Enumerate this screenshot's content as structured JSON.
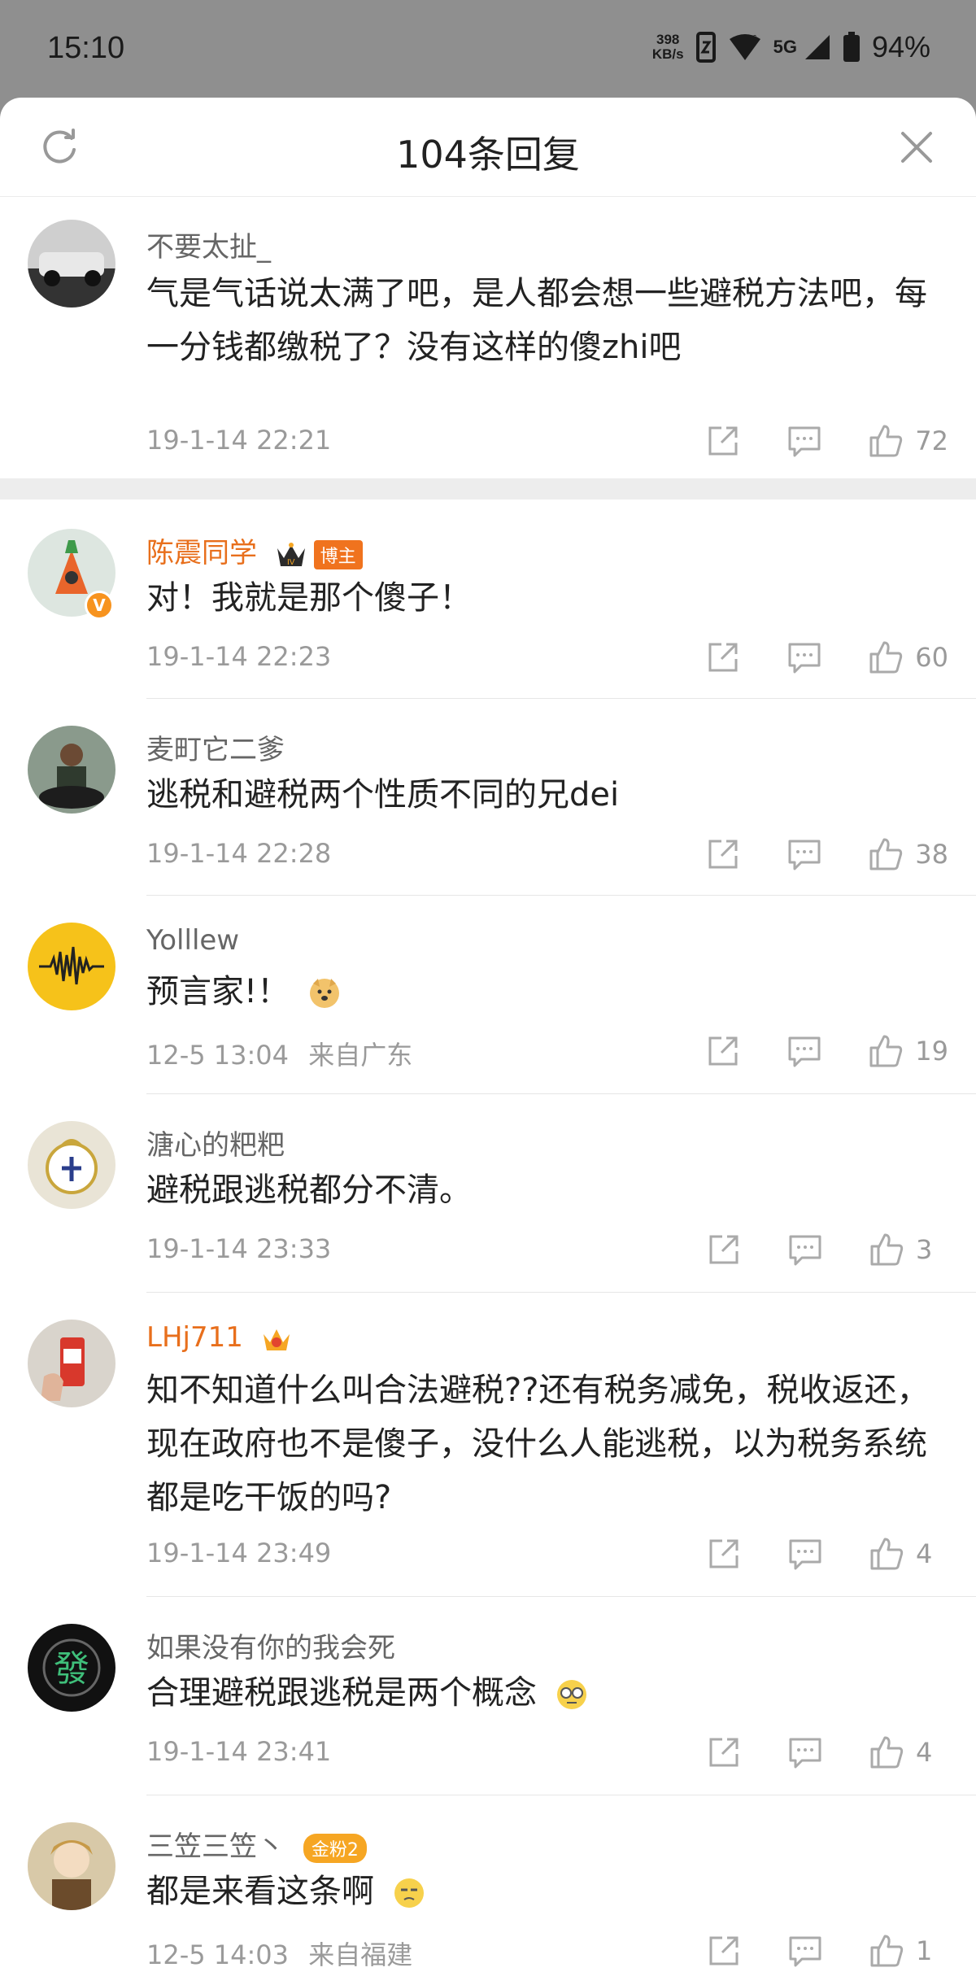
{
  "status_bar": {
    "time": "15:10",
    "net_speed_value": "398",
    "net_speed_unit": "KB/s",
    "network": "5G",
    "battery": "94%"
  },
  "header": {
    "title": "104条回复",
    "refresh_icon": "refresh-icon",
    "close_icon": "close-icon"
  },
  "accent_color": "#e86f1c",
  "comments": [
    {
      "user": "不要太扯_",
      "text": "气是气话说太满了吧，是人都会想一些避税方法吧，每一分钱都缴税了？没有这样的傻zhi吧",
      "time": "19-1-14 22:21",
      "likes": "72"
    },
    {
      "user": "陈震同学",
      "badge": "博主",
      "verified": "V",
      "text": "对！我就是那个傻子！",
      "time": "19-1-14 22:23",
      "likes": "60"
    },
    {
      "user": "麦町它二爹",
      "text": "逃税和避税两个性质不同的兄dei",
      "time": "19-1-14 22:28",
      "likes": "38"
    },
    {
      "user": "Yolllew",
      "text": "预言家!！",
      "time": "12-5 13:04",
      "location": "来自广东",
      "likes": "19"
    },
    {
      "user": "溏心的粑粑",
      "text": "避税跟逃税都分不清。",
      "time": "19-1-14 23:33",
      "likes": "3"
    },
    {
      "user": "LHj711",
      "text": "知不知道什么叫合法避税??还有税务减免，税收返还，现在政府也不是傻子，没什么人能逃税，以为税务系统都是吃干饭的吗?",
      "time": "19-1-14 23:49",
      "likes": "4"
    },
    {
      "user": "如果没有你的我会死",
      "text": "合理避税跟逃税是两个概念",
      "time": "19-1-14 23:41",
      "likes": "4"
    },
    {
      "user": "三笠三笠丶",
      "badge": "金粉2",
      "text": "都是来看这条啊",
      "time": "12-5 14:03",
      "location": "来自福建",
      "likes": "1"
    }
  ]
}
